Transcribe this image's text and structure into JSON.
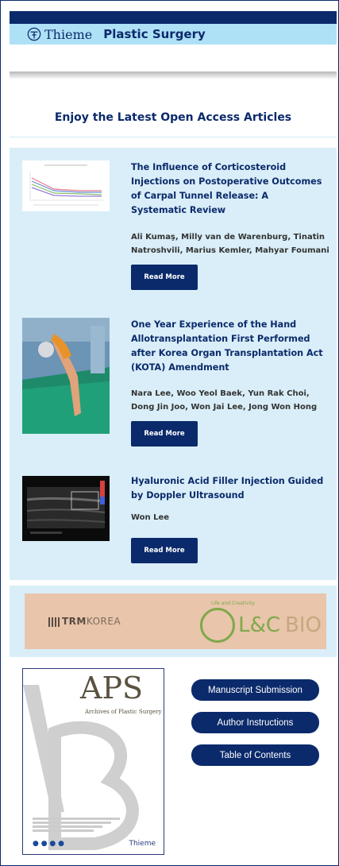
{
  "header": {
    "brand_name": "Thieme",
    "journal": "Plastic Surgery"
  },
  "section": {
    "title": "Enjoy the Latest Open Access Articles"
  },
  "articles": [
    {
      "title": "The Influence of Corticosteroid Injections on Postoperative Outcomes of Carpal Tunnel Release: A Systematic Review",
      "authors": "Ali Kumaş, Milly van de Warenburg, Tinatin Natroshvili, Marius Kemler, Mahyar Foumani",
      "button": "Read More",
      "thumbnail": "line-chart-thumbnail"
    },
    {
      "title": "One Year Experience of the Hand Allotransplantation First Performed after Korea Organ Transplantation Act (KOTA) Amendment",
      "authors": "Nara Lee, Woo Yeol Baek, Yun Rak Choi, Dong Jin Joo, Won Jai Lee, Jong Won Hong",
      "button": "Read More",
      "thumbnail": "surgery-photo-thumbnail"
    },
    {
      "title": "Hyaluronic Acid Filler Injection Guided by Doppler Ultrasound",
      "authors": "Won Lee",
      "button": "Read More",
      "thumbnail": "ultrasound-thumbnail"
    }
  ],
  "ad": {
    "left_brand_bold": "TRM",
    "left_brand_rest": "KOREA",
    "right_brand": "L&C",
    "right_brand_suffix": "BIO",
    "right_tag": "Life and Creativity"
  },
  "cover": {
    "title": "APS",
    "subtitle": "Archives of Plastic Surgery",
    "publisher": "Thieme"
  },
  "links": {
    "manuscript": "Manuscript Submission",
    "instructions": "Author Instructions",
    "toc": "Table of Contents"
  },
  "colors": {
    "navy": "#0b2a6b",
    "light_blue": "#aee0f6",
    "panel_blue": "#d9eef8"
  }
}
